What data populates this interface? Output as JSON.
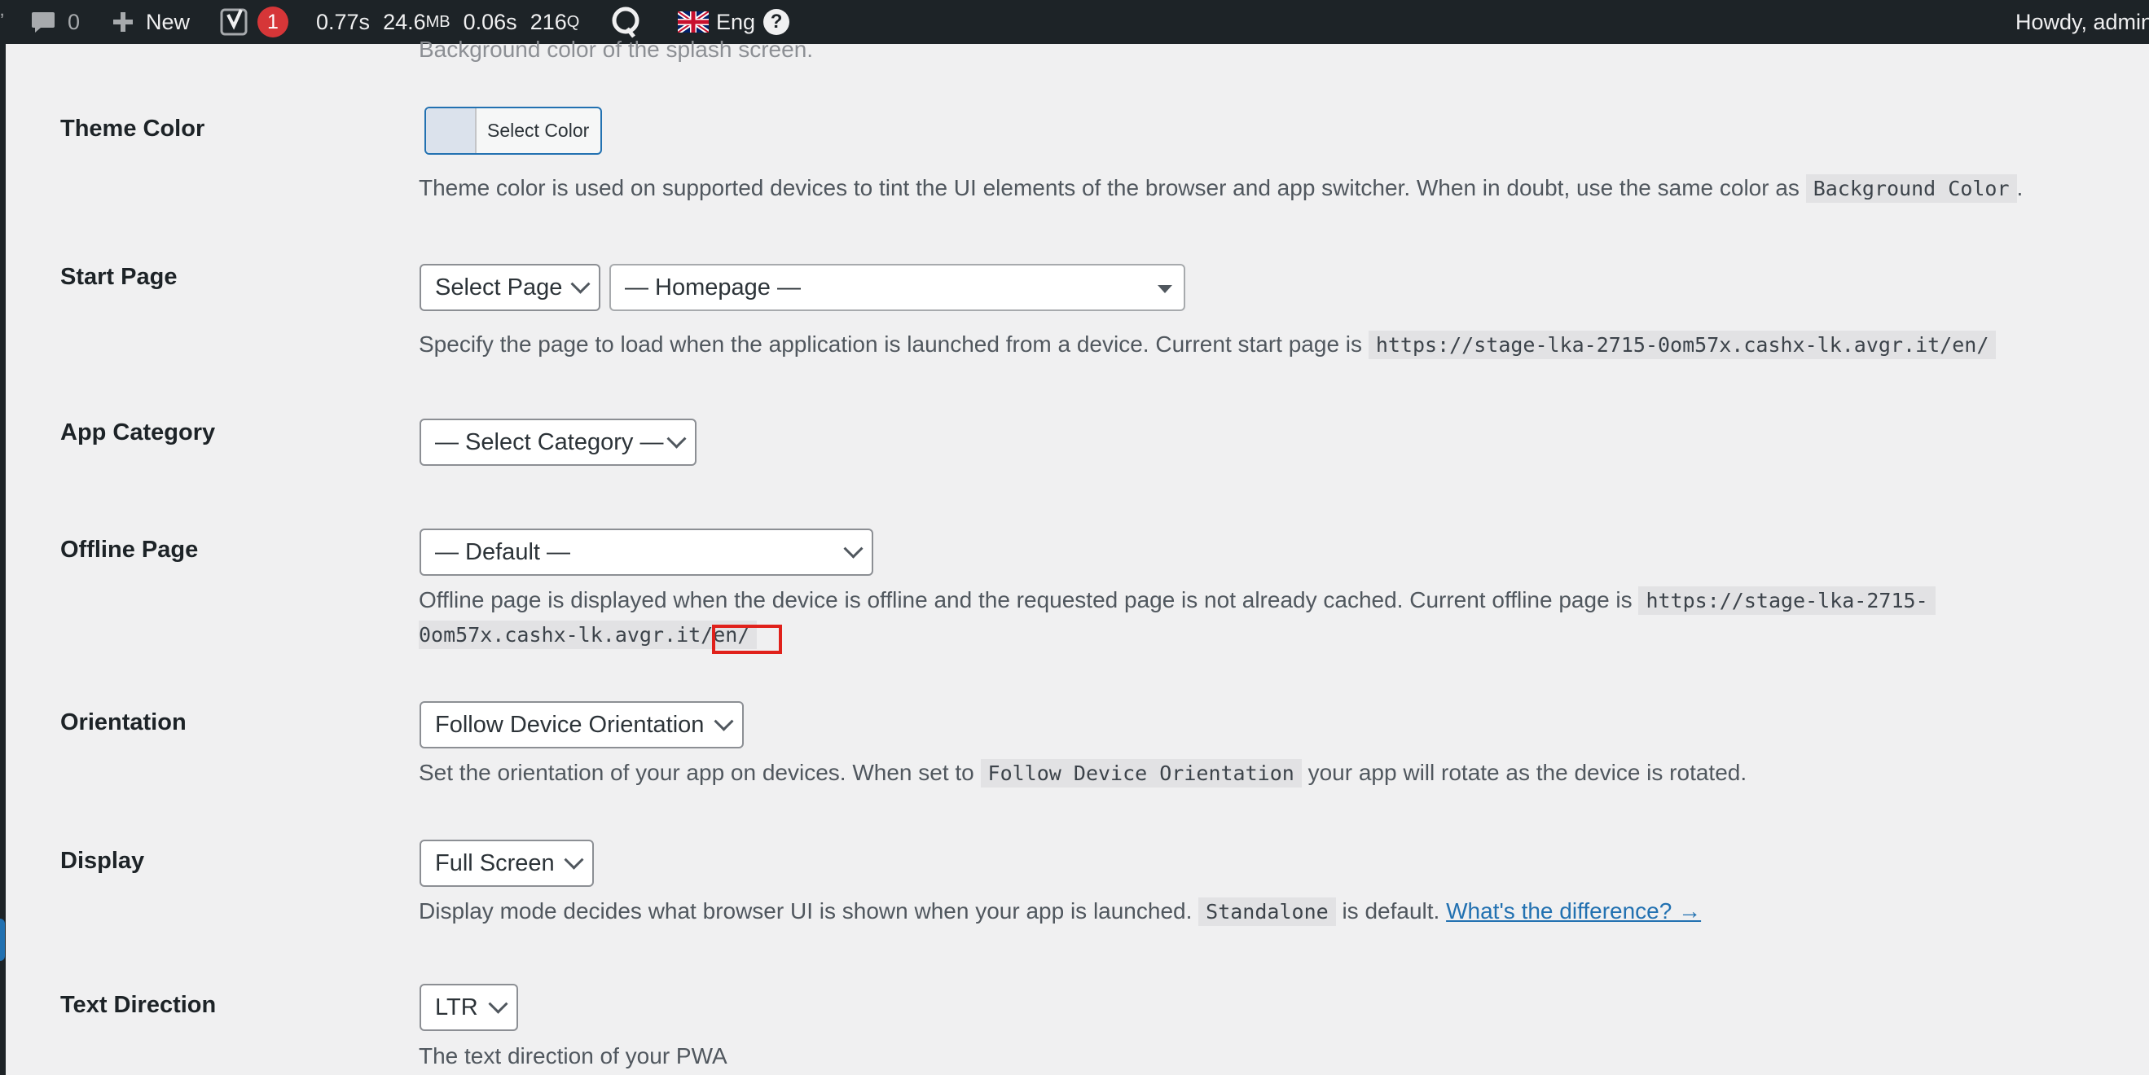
{
  "admin_bar": {
    "comments_count": "0",
    "new_label": "New",
    "yoast_badge": "1",
    "perf_time1": "0.77s",
    "perf_memory": "24.6",
    "perf_memory_unit": "MB",
    "perf_time2": "0.06s",
    "perf_queries": "216",
    "perf_queries_unit": "Q",
    "lang_label": "Eng",
    "help_glyph": "?",
    "howdy": "Howdy, admin"
  },
  "partial_top_text": "Background color of the splash screen.",
  "fields": {
    "theme_color": {
      "label": "Theme Color",
      "button_label": "Select Color",
      "desc_pre": "Theme color is used on supported devices to tint the UI elements of the browser and app switcher. When in doubt, use the same color as",
      "desc_code": "Background Color",
      "desc_post": "."
    },
    "start_page": {
      "label": "Start Page",
      "select_type": "Select Page",
      "select_page": "— Homepage —",
      "desc_pre": "Specify the page to load when the application is launched from a device. Current start page is",
      "desc_code": "https://stage-lka-2715-0om57x.cashx-lk.avgr.it/en/"
    },
    "app_category": {
      "label": "App Category",
      "select": "— Select Category —"
    },
    "offline_page": {
      "label": "Offline Page",
      "select": "— Default —",
      "desc_pre": "Offline page is displayed when the device is offline and the requested page is not already cached. Current offline page is",
      "desc_code_line1": "https://stage-lka-2715-",
      "desc_code_line2": "0om57x.cashx-lk.avgr.it/en/"
    },
    "orientation": {
      "label": "Orientation",
      "select": "Follow Device Orientation",
      "desc_pre": "Set the orientation of your app on devices. When set to",
      "desc_code": "Follow Device Orientation",
      "desc_post": "your app will rotate as the device is rotated."
    },
    "display": {
      "label": "Display",
      "select": "Full Screen",
      "desc_pre": "Display mode decides what browser UI is shown when your app is launched.",
      "desc_code": "Standalone",
      "desc_mid": "is default.",
      "desc_link": "What's the difference? →"
    },
    "text_direction": {
      "label": "Text Direction",
      "select": "LTR",
      "desc": "The text direction of your PWA"
    }
  },
  "colors": {
    "admin_bar_bg": "#1d2327",
    "badge_red": "#d63638",
    "link_blue": "#2271b1",
    "highlight_red": "#e0211b"
  }
}
